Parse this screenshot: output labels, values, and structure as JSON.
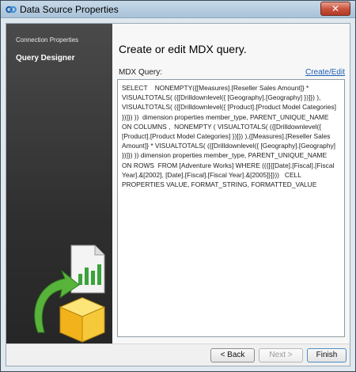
{
  "window": {
    "title": "Data Source Properties",
    "close_glyph": "✕"
  },
  "sidebar": {
    "items": [
      {
        "label": "Connection Properties"
      },
      {
        "label": "Query Designer"
      }
    ]
  },
  "main": {
    "heading": "Create or edit MDX query.",
    "mdx_label": "MDX Query:",
    "create_edit_link": "Create/Edit",
    "query_text": "SELECT    NONEMPTY({[Measures].[Reseller Sales Amount]} * VISUALTOTALS( ({[Drilldownlevel({ [Geography].[Geography] })]}) ), VISUALTOTALS( ({[Drilldownlevel({ [Product].[Product Model Categories] })]}) ))  dimension properties member_type, PARENT_UNIQUE_NAME  ON COLUMNS ,  NONEMPTY ( VISUALTOTALS( ({[Drilldownlevel({ [Product].[Product Model Categories] })]}) ),{[Measures].[Reseller Sales Amount]} * VISUALTOTALS( ({[Drilldownlevel({ [Geography].[Geography] })]}) )) dimension properties member_type, PARENT_UNIQUE_NAME  ON ROWS  FROM [Adventure Works] WHERE (({[{[Date].[Fiscal].[Fiscal Year].&[2002], [Date].[Fiscal].[Fiscal Year].&[2005]}]}))   CELL PROPERTIES VALUE, FORMAT_STRING, FORMATTED_VALUE"
  },
  "footer": {
    "back": "< Back",
    "next": "Next >",
    "finish": "Finish"
  },
  "icons": {
    "title": "data-source-icon",
    "art": "document-chart-cube-icon"
  },
  "colors": {
    "sidebar": "#333333",
    "link": "#1a5fb4",
    "close": "#c7503a"
  }
}
